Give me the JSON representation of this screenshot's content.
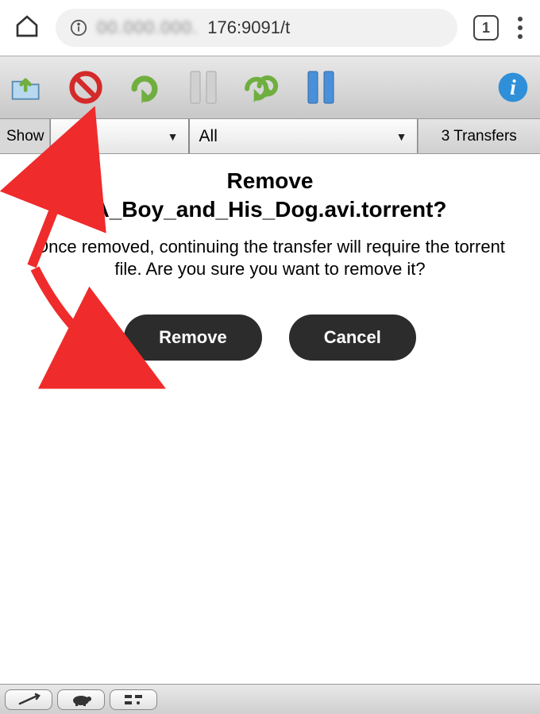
{
  "browser": {
    "url_obscured": "00.000.000.",
    "url_visible": "176:9091/t",
    "tab_count": "1"
  },
  "filters": {
    "show_label": "Show",
    "filter1": "",
    "filter2": "All",
    "transfer_count": "3 Transfers"
  },
  "dialog": {
    "title_line1": "Remove",
    "title_line2": "A_Boy_and_His_Dog.avi.torrent?",
    "body": "Once removed, continuing the transfer will require the torrent file. Are you sure you want to remove it?",
    "remove_label": "Remove",
    "cancel_label": "Cancel"
  }
}
